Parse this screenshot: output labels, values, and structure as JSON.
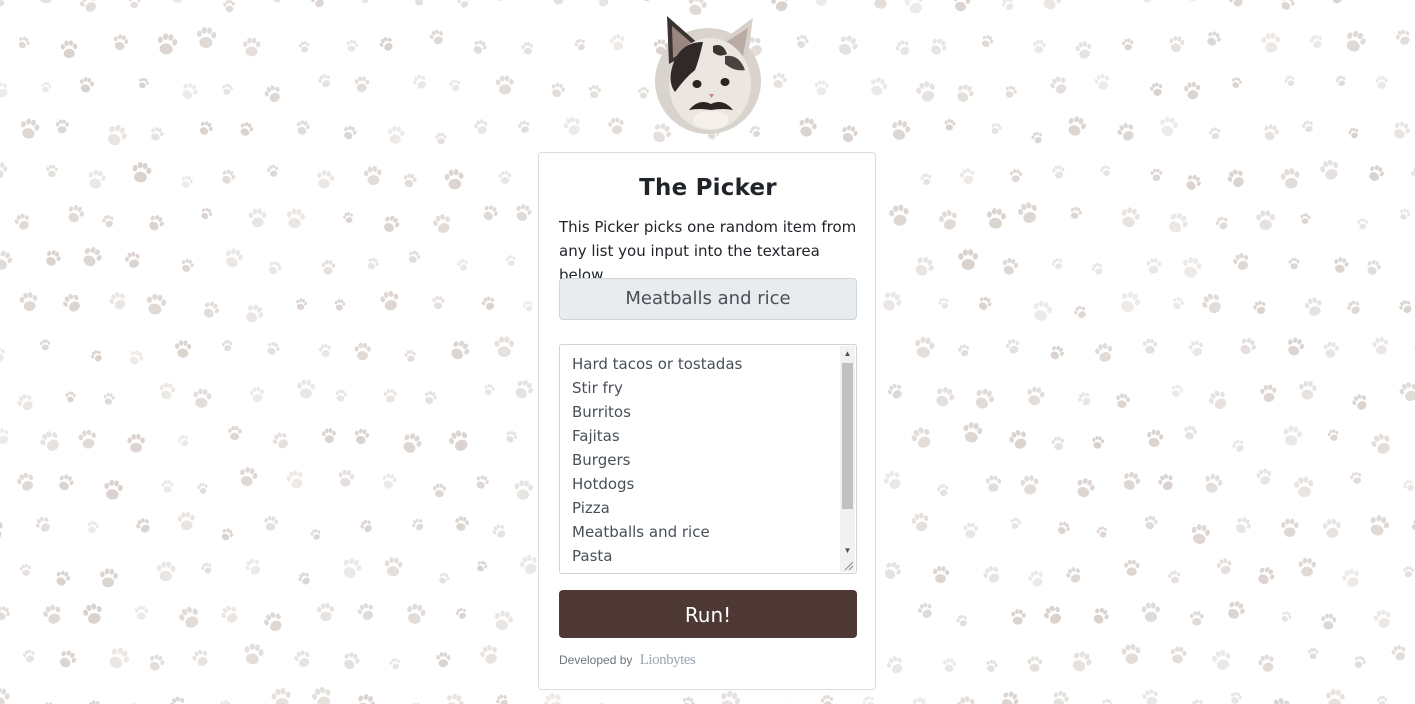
{
  "app": {
    "title": "The Picker",
    "description": "This Picker picks one random item from any list you input into the textarea below."
  },
  "result": {
    "value": "Meatballs and rice"
  },
  "list": {
    "items": [
      "Hard tacos or tostadas",
      "Stir fry",
      "Burritos",
      "Fajitas",
      "Burgers",
      "Hotdogs",
      "Pizza",
      "Meatballs and rice",
      "Pasta"
    ]
  },
  "run_button": {
    "label": "Run!"
  },
  "footer": {
    "prefix": "Developed by",
    "logo_text": "Lionbytes"
  },
  "colors": {
    "run_button_bg": "#4e3833",
    "paw_color": "#cfc6c0",
    "result_bg": "#e9ecef"
  },
  "icons": {
    "background": "paw-print-pattern",
    "avatar": "cat-face-avatar",
    "scroll_up": "triangle-up",
    "scroll_down": "triangle-down",
    "resize": "resize-grip-icon"
  }
}
